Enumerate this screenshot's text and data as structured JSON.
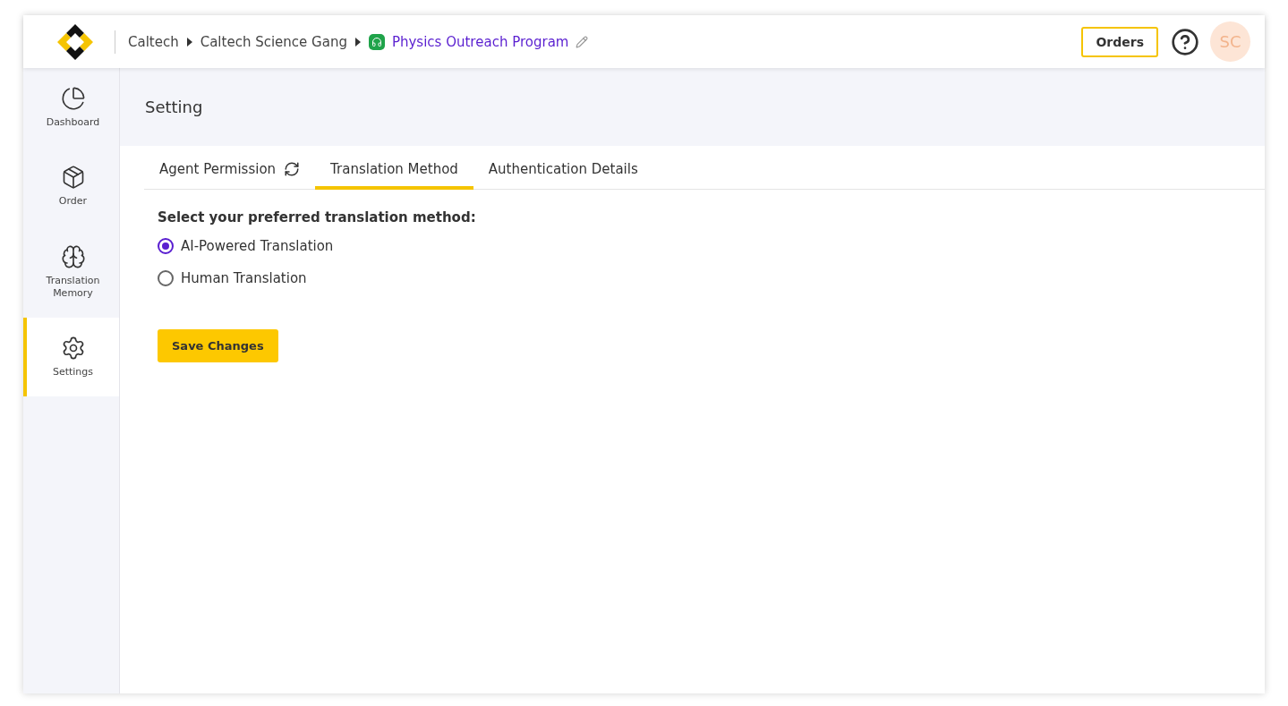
{
  "header": {
    "breadcrumbs": [
      {
        "label": "Caltech",
        "kind": "plain"
      },
      {
        "label": "Caltech Science Gang",
        "kind": "plain"
      },
      {
        "label": "Physics Outreach Program",
        "kind": "current"
      }
    ],
    "orders_button": "Orders",
    "avatar": "SC"
  },
  "sidebar": {
    "items": [
      {
        "label": "Dashboard",
        "selected": false
      },
      {
        "label": "Order",
        "selected": false
      },
      {
        "label": "Translation Memory",
        "selected": false
      },
      {
        "label": "Settings",
        "selected": true
      }
    ]
  },
  "page_title": "Setting",
  "tabs": [
    {
      "label": "Agent Permission",
      "selected": false,
      "refresh": true
    },
    {
      "label": "Translation Method",
      "selected": true,
      "refresh": false
    },
    {
      "label": "Authentication Details",
      "selected": false,
      "refresh": false
    }
  ],
  "form": {
    "prompt": "Select your preferred translation method:",
    "options": [
      {
        "label": "AI-Powered Translation",
        "selected": true
      },
      {
        "label": "Human Translation",
        "selected": false
      }
    ],
    "save_button": "Save Changes"
  }
}
